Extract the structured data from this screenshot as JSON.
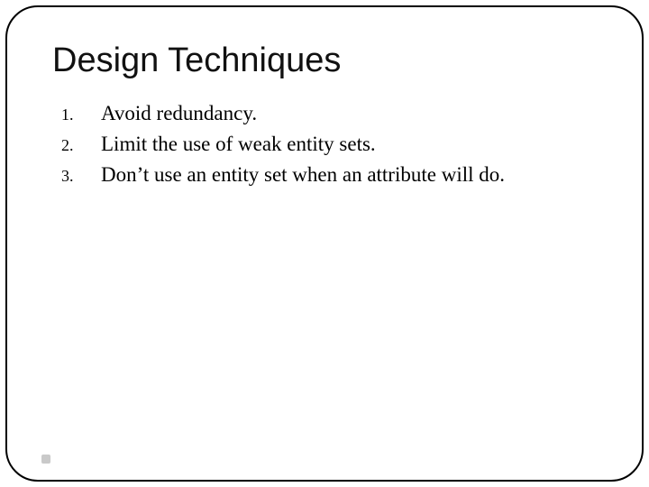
{
  "title": "Design Techniques",
  "items": [
    {
      "num": "1.",
      "text": "Avoid redundancy."
    },
    {
      "num": "2.",
      "text": "Limit the use of weak entity sets."
    },
    {
      "num": "3.",
      "text": "Don’t use an entity set when an attribute will do."
    }
  ]
}
